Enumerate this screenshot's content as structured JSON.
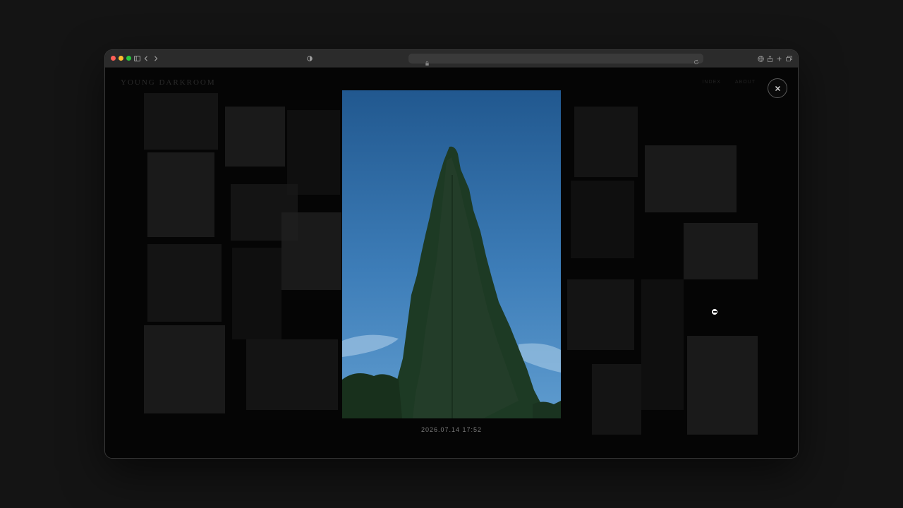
{
  "browser": {
    "traffic_lights": [
      "#ff5f57",
      "#febc2e",
      "#28c840"
    ],
    "icons": [
      "sidebar-icon",
      "back-icon",
      "forward-icon",
      "shield-icon",
      "lock-icon",
      "reload-icon",
      "globe-icon",
      "share-icon",
      "new-tab-icon",
      "tabs-icon"
    ]
  },
  "site": {
    "logo_text": "YOUNG DARKROOM",
    "nav": [
      "INDEX",
      "ABOUT"
    ]
  },
  "viewer": {
    "photo_description_icon": "tree-photo",
    "caption": "2026.07.14 17:52",
    "close_icon": "close-icon"
  }
}
